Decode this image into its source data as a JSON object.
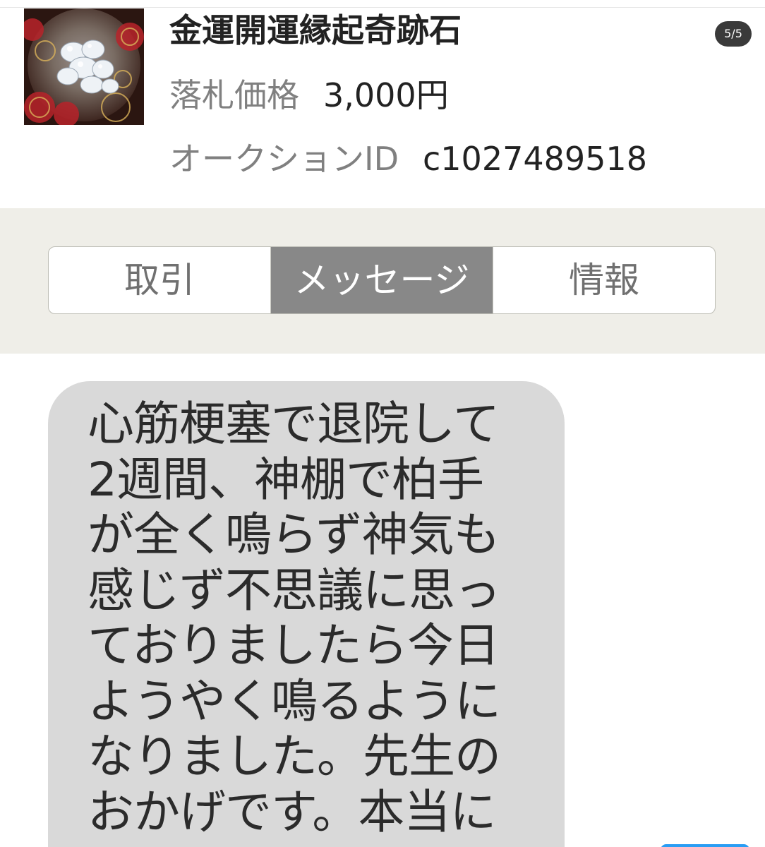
{
  "header": {
    "title": "金運開運縁起奇跡石",
    "price_label": "落札価格",
    "price_value": "3,000円",
    "auction_id_label": "オークションID",
    "auction_id_value": "c1027489518",
    "page_counter": "5/5"
  },
  "tabs": [
    {
      "label": "取引",
      "active": false
    },
    {
      "label": "メッセージ",
      "active": true
    },
    {
      "label": "情報",
      "active": false
    }
  ],
  "message": {
    "text": "心筋梗塞で退院して2週間、神棚で柏手が全く鳴らず神気も感じず不思議に思っておりましたら今日ようやく鳴るようになりました。先生のおかげです。本当に"
  },
  "colors": {
    "tab_active_bg": "#888888",
    "tab_band_bg": "#efeee8",
    "bubble_bg": "#d9d9d9",
    "send_button": "#2a9df4"
  },
  "icons": {
    "thumbnail": "crystal-stones-image"
  }
}
